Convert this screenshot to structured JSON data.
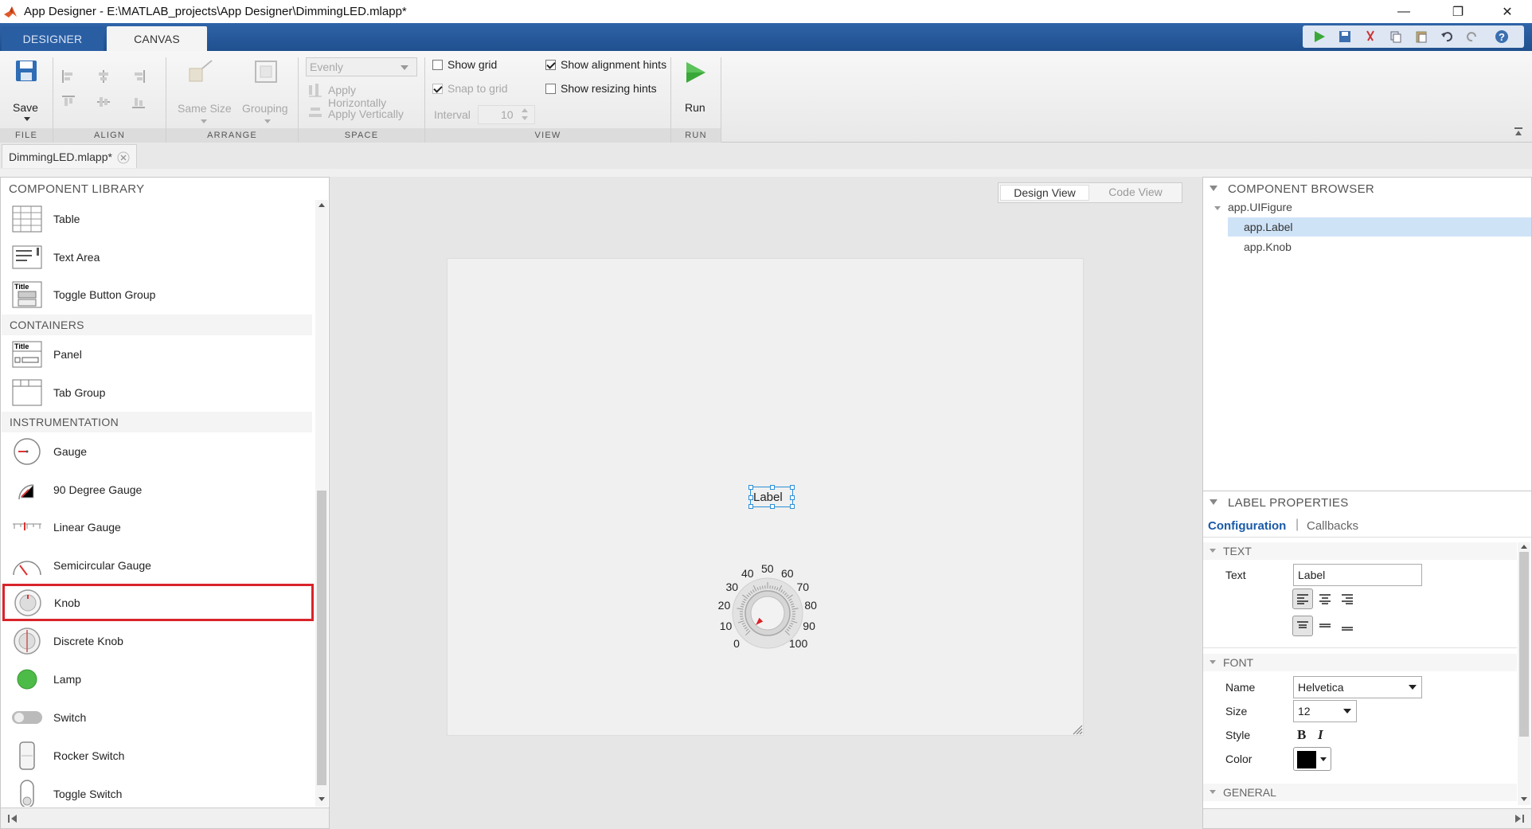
{
  "window": {
    "title": "App Designer - E:\\MATLAB_projects\\App Designer\\DimmingLED.mlapp*",
    "minimize": "—",
    "restore": "❐",
    "close": "✕"
  },
  "maintabs": [
    "DESIGNER",
    "CANVAS"
  ],
  "ribbon": {
    "save": "Save",
    "same_size": "Same Size",
    "grouping": "Grouping",
    "space_select": "Evenly",
    "apply_h": "Apply Horizontally",
    "apply_v": "Apply Vertically",
    "show_grid": "Show grid",
    "snap_grid": "Snap to grid",
    "interval_label": "Interval",
    "interval_value": "10",
    "show_align": "Show alignment hints",
    "show_resize": "Show resizing hints",
    "run": "Run",
    "groups": [
      "FILE",
      "ALIGN",
      "ARRANGE",
      "SPACE",
      "VIEW",
      "RUN"
    ]
  },
  "file_tab": "DimmingLED.mlapp*",
  "library": {
    "header": "COMPONENT LIBRARY",
    "items_top": [
      "Table",
      "Text Area",
      "Toggle Button Group"
    ],
    "containers_header": "CONTAINERS",
    "containers": [
      "Panel",
      "Tab Group"
    ],
    "instrumentation_header": "INSTRUMENTATION",
    "instrumentation": [
      "Gauge",
      "90 Degree Gauge",
      "Linear Gauge",
      "Semicircular Gauge",
      "Knob",
      "Discrete Knob",
      "Lamp",
      "Switch",
      "Rocker Switch",
      "Toggle Switch"
    ],
    "selected": "Knob"
  },
  "canvas": {
    "design_view": "Design View",
    "code_view": "Code View",
    "label_text": "Label",
    "knob_ticks": [
      "0",
      "10",
      "20",
      "30",
      "40",
      "50",
      "60",
      "70",
      "80",
      "90",
      "100"
    ],
    "knob_value": 0
  },
  "browser": {
    "header": "COMPONENT BROWSER",
    "root": "app.UIFigure",
    "children": [
      "app.Label",
      "app.Knob"
    ],
    "selected": "app.Label"
  },
  "props": {
    "header": "LABEL PROPERTIES",
    "tab_config": "Configuration",
    "tab_callbacks": "Callbacks",
    "text_section": "TEXT",
    "text_label": "Text",
    "text_value": "Label",
    "font_section": "FONT",
    "name_label": "Name",
    "name_value": "Helvetica",
    "size_label": "Size",
    "size_value": "12",
    "style_label": "Style",
    "bold": "B",
    "italic": "I",
    "color_label": "Color",
    "color_value": "#000000",
    "general_section": "GENERAL"
  },
  "colors": {
    "accent": "#1a5aa8",
    "selection_red": "#d9242b",
    "selected_row": "#cfe3f7",
    "ribbon_blue": "#2a5ea3"
  }
}
